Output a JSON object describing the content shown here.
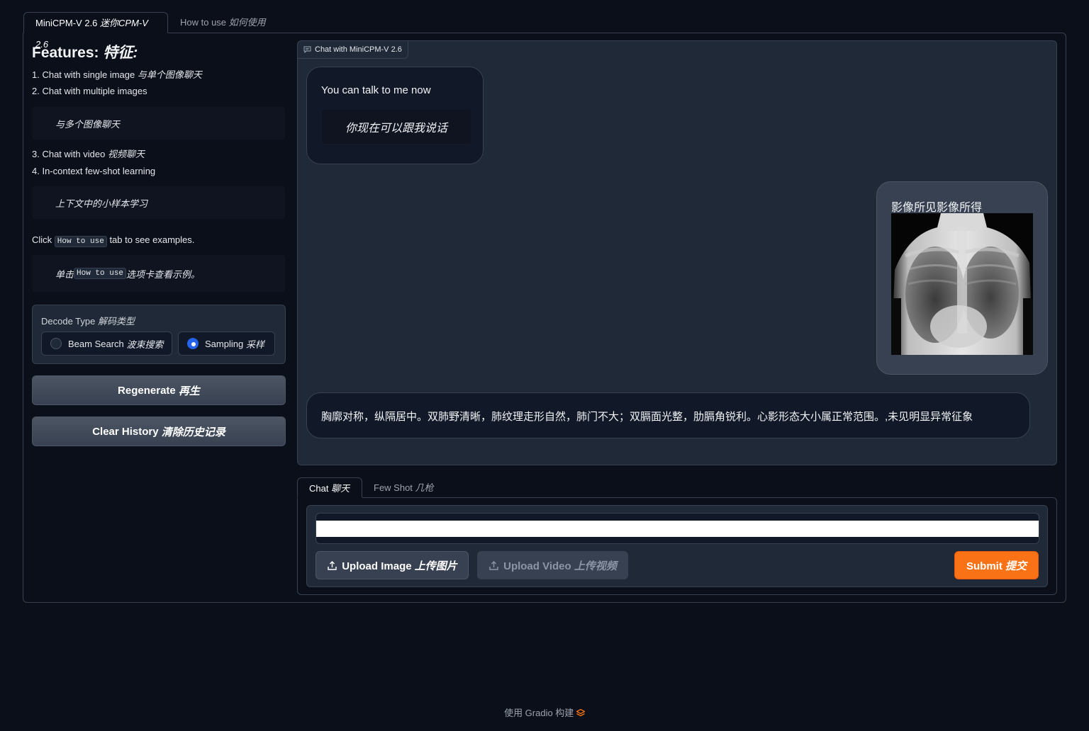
{
  "tabs": {
    "model": {
      "label": "MiniCPM-V 2.6",
      "label_cn": "迷你CPM-V 2.6"
    },
    "howto": {
      "label": "How to use",
      "label_cn": "如何使用"
    }
  },
  "features": {
    "title": "Features:",
    "title_cn": "特征:",
    "item1": "1. Chat with single image",
    "item1_cn": "与单个图像聊天",
    "item2": "2. Chat with multiple images",
    "item2_quote": "与多个图像聊天",
    "item3": "3. Chat with video",
    "item3_cn": "视频聊天",
    "item4": "4. In-context few-shot learning",
    "item4_quote": "上下文中的小样本学习",
    "click_pre": "Click",
    "click_code": "How to use",
    "click_post": "tab to see examples.",
    "cn_pre": "单击",
    "cn_code": "How to use",
    "cn_post": "选项卡查看示例。"
  },
  "decode": {
    "label": "Decode Type",
    "label_cn": "解码类型",
    "options": [
      {
        "label": "Beam Search",
        "label_cn": "波束搜索",
        "checked": false
      },
      {
        "label": "Sampling",
        "label_cn": "采样",
        "checked": true
      }
    ]
  },
  "buttons": {
    "regenerate": "Regenerate",
    "regenerate_cn": "再生",
    "clear": "Clear History",
    "clear_cn": "清除历史记录"
  },
  "chatbot": {
    "label": "Chat with MiniCPM-V 2.6",
    "messages": [
      {
        "role": "bot",
        "text": "You can talk to me now",
        "quote": "你现在可以跟我说话"
      },
      {
        "role": "user",
        "text": "影像所见影像所得",
        "image": "chest-xray"
      },
      {
        "role": "bot",
        "text": "胸廓对称，纵隔居中。双肺野清晰，肺纹理走形自然，肺门不大；双膈面光整，肋膈角锐利。心影形态大小属正常范围。,未见明显异常征象"
      }
    ]
  },
  "input_tabs": {
    "chat": {
      "label": "Chat",
      "label_cn": "聊天"
    },
    "few_shot": {
      "label": "Few Shot",
      "label_cn": "几枪"
    }
  },
  "input": {
    "value": "",
    "placeholder": ""
  },
  "actions": {
    "upload_image": "Upload Image",
    "upload_image_cn": "上传图片",
    "upload_video": "Upload Video",
    "upload_video_cn": "上传视频",
    "submit": "Submit",
    "submit_cn": "提交"
  },
  "footer": {
    "text": "使用 Gradio 构建"
  },
  "colors": {
    "accent": "#f97316",
    "radio_checked": "#2563eb",
    "background": "#0b0f19"
  }
}
